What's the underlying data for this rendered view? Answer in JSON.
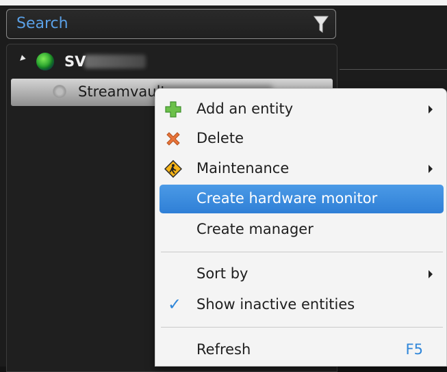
{
  "search": {
    "placeholder": "Search"
  },
  "tree": {
    "root": {
      "label": "SV"
    },
    "child": {
      "label": "Streamvault"
    }
  },
  "menu": {
    "items": [
      {
        "label": "Add an entity",
        "icon": "plus-icon",
        "submenu": true
      },
      {
        "label": "Delete",
        "icon": "delete-x-icon",
        "submenu": false
      },
      {
        "label": "Maintenance",
        "icon": "maintenance-sign-icon",
        "submenu": true
      },
      {
        "label": "Create hardware monitor",
        "icon": "",
        "submenu": false,
        "highlighted": true
      },
      {
        "label": "Create manager",
        "icon": "",
        "submenu": false
      },
      {
        "label": "Sort by",
        "icon": "",
        "submenu": true
      },
      {
        "label": "Show inactive entities",
        "icon": "checkmark-icon",
        "submenu": false,
        "checked": true
      },
      {
        "label": "Refresh",
        "icon": "",
        "submenu": false,
        "shortcut": "F5"
      }
    ]
  },
  "colors": {
    "accent": "#2f86d9",
    "highlight": "#3a8ad9"
  }
}
